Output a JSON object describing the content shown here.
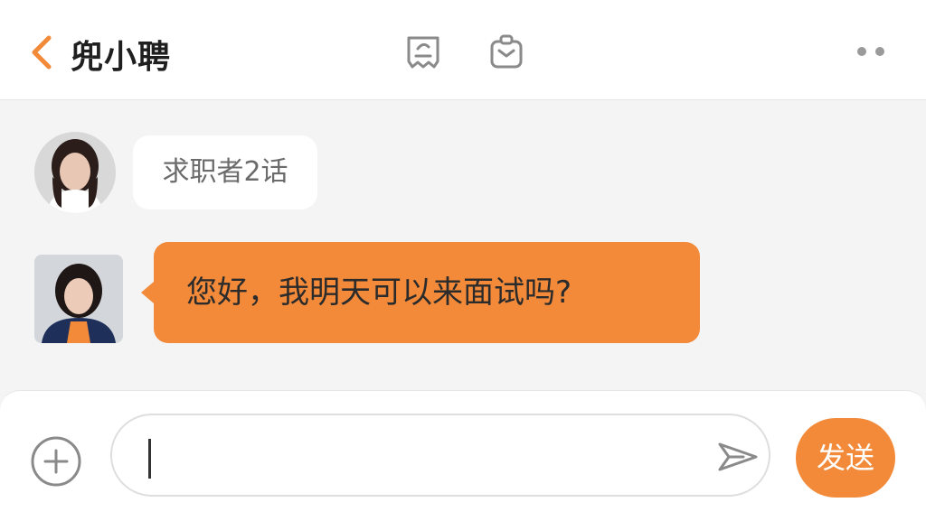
{
  "header": {
    "title": "兜小聘",
    "icons": [
      "back-chevron-icon",
      "resume-icon",
      "clipboard-icon",
      "more-dots-icon"
    ]
  },
  "messages": [
    {
      "side": "left",
      "avatar": "avatar-woman-1",
      "text": "求职者2话",
      "style": "white"
    },
    {
      "side": "left",
      "avatar": "avatar-woman-2",
      "text": "您好，我明天可以来面试吗?",
      "style": "orange"
    }
  ],
  "input": {
    "value": "",
    "placeholder": ""
  },
  "actions": {
    "send_label": "发送"
  },
  "colors": {
    "accent": "#f28a3a",
    "header_bg": "#ffffff",
    "chat_bg": "#f4f4f4"
  }
}
